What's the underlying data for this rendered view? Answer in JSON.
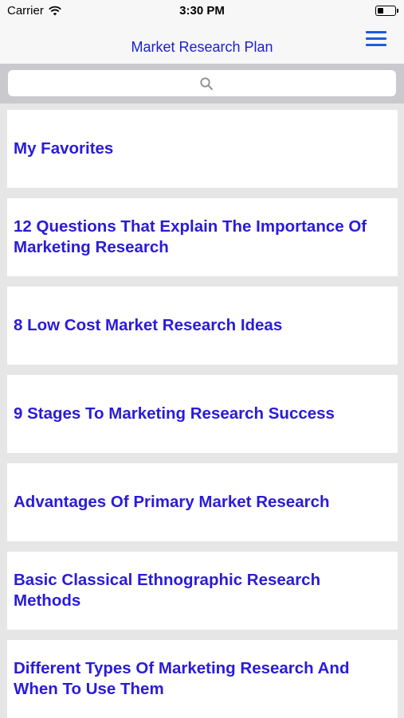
{
  "status_bar": {
    "carrier": "Carrier",
    "time": "3:30 PM",
    "battery_level": 0.35
  },
  "nav": {
    "title": "Market Research Plan",
    "menu_icon": "hamburger-menu-icon"
  },
  "search": {
    "placeholder": "",
    "icon": "search-icon"
  },
  "list": {
    "items": [
      {
        "label": "My Favorites"
      },
      {
        "label": "12 Questions That Explain The Importance Of Marketing Research"
      },
      {
        "label": "8 Low Cost Market Research Ideas"
      },
      {
        "label": "9 Stages To Marketing Research Success"
      },
      {
        "label": "Advantages Of Primary Market Research"
      },
      {
        "label": "Basic Classical Ethnographic Research Methods"
      },
      {
        "label": "Different Types Of Marketing Research And When To Use Them"
      }
    ]
  },
  "colors": {
    "accent": "#1a1fcf",
    "item_text": "#2a1bd8",
    "search_bg": "#c9c9ce"
  }
}
